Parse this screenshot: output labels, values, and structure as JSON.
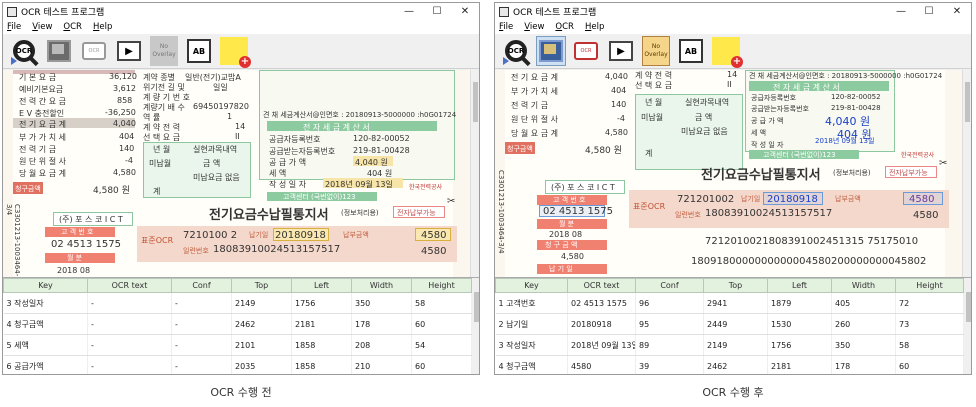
{
  "left": {
    "title": "OCR 테스트 프로그램",
    "menu": [
      "File",
      "View",
      "OCR",
      "Help"
    ],
    "toolbar": {
      "no_overlay": "No Overlay",
      "ocr_label": "OCR"
    },
    "document": {
      "rows": [
        {
          "label": "기 본 요 금",
          "value": "36,120"
        },
        {
          "label": "예비기본요금",
          "value": "3,612"
        },
        {
          "label": "전 력 간 요 금",
          "value": "858"
        },
        {
          "label": "E V 충전할인",
          "value": "-36,250"
        },
        {
          "label": "전 기 요 금 계",
          "value": "4,040"
        },
        {
          "label": "부 가 가 치 세",
          "value": "404"
        },
        {
          "label": "전    력    기 금",
          "value": "140"
        },
        {
          "label": "원 단 위 절 사",
          "value": "-4"
        },
        {
          "label": "당 월 요 금 계",
          "value": "4,580"
        }
      ],
      "request_label": "청구금액",
      "request_value": "4,580 원",
      "mid_labels": [
        "계약 종별",
        "위기전 길 및",
        "계 량 기 번 호",
        "계량기 배 수",
        "역 률",
        "계 약 전 력",
        "선 택 요 금"
      ],
      "mid_values": [
        "일반(전기)교밥A",
        "일일",
        "69450197820",
        "1",
        "90",
        "14",
        "II"
      ],
      "bill_title": "전기요금수납필통지서",
      "bill_sub": "(정보처리용)",
      "tax_title": "전 자 세 금 계 산 서",
      "tax_header": "견 채 세금계산서@인면호 : 20180913-5000000 :h0G01724",
      "tax_rows": [
        {
          "label": "공급자등록번호",
          "value": "120-82-00052"
        },
        {
          "label": "공급받는자등록번호",
          "value": "219-81-00428"
        },
        {
          "label": "공 급 가 액",
          "value": "4,040 원"
        },
        {
          "label": "세 액",
          "value": "404 원"
        },
        {
          "label": "작 성 일 자",
          "value": "2018년 09월 13일"
        }
      ],
      "customer_center": "고객센터 (국번없이)123",
      "company": "(주) 포 스 코 I C T",
      "customer_no_label": "고 객 번 호",
      "customer_no": "02 4513 1575",
      "month_label": "월 분",
      "month": "2018 08",
      "ocr_label": "표준OCR",
      "biz_no": "7210100 2",
      "date_label": "납기일",
      "date": "20180918",
      "pay_label": "납부금액",
      "pay": "4580",
      "account_label": "일련번호",
      "account": "18083910024513157517",
      "pay2": "4580",
      "side_code": "C3301213-1003464-3/4",
      "usage_month": "2018 08",
      "usage_col": [
        "년 월",
        "실현과목내역"
      ],
      "usage_col2": [
        "미납월",
        "금 액"
      ],
      "usage_none": "미납요금 없음",
      "usage_total": "계",
      "electronic_label": "전자납부가능",
      "kepco": "한국전력공사"
    },
    "grid": {
      "columns": [
        "Key",
        "OCR text",
        "Conf",
        "Top",
        "Left",
        "Width",
        "Height"
      ],
      "rows": [
        [
          "3 작성일자",
          "-",
          "-",
          "2149",
          "1756",
          "350",
          "58"
        ],
        [
          "4 청구금액",
          "-",
          "-",
          "2462",
          "2181",
          "178",
          "60"
        ],
        [
          "5 세액",
          "-",
          "-",
          "2101",
          "1858",
          "208",
          "54"
        ],
        [
          "6 공급가액",
          "-",
          "-",
          "2035",
          "1858",
          "210",
          "60"
        ]
      ]
    },
    "caption": "OCR 수행 전"
  },
  "right": {
    "title": "OCR 테스트 프로그램",
    "menu": [
      "File",
      "View",
      "OCR",
      "Help"
    ],
    "toolbar": {
      "no_overlay": "No Overlay",
      "ocr_label": "OCR"
    },
    "document": {
      "top_row": "계 약 전 력",
      "top_value": "14",
      "rows": [
        {
          "label": "전 기 요 금 계",
          "value": "4,040"
        },
        {
          "label": "부 가 가 치 세",
          "value": "404"
        },
        {
          "label": "전    력    기 금",
          "value": "140"
        },
        {
          "label": "원 단 위 절 사",
          "value": "-4"
        },
        {
          "label": "당 월 요 금 계",
          "value": "4,580"
        }
      ],
      "request_label": "청구금액",
      "request_value": "4,580 원",
      "sel_label": "선 택 요 금",
      "sel_value": "II",
      "tax_header": "견 채 세금계산서@인면호 : 20180913-5000000 :h0G01724",
      "tax_title": "전 자 세 금 계 산 서",
      "tax_rows": [
        {
          "label": "공급자등록번호",
          "value": "120-82-00052"
        },
        {
          "label": "공급받는자등록번호",
          "value": "219-81-00428"
        },
        {
          "label": "공 급 가 액",
          "value": "4,040 원"
        },
        {
          "label": "세 액",
          "value": "404 원"
        },
        {
          "label": "작 성 일 자",
          "value": "2018년 09월 13일"
        }
      ],
      "customer_center": "고객센터 (국번없이)123",
      "bill_title": "전기요금수납필통지서",
      "bill_sub": "(정보처리용)",
      "company": "(주) 포 스 코 I C T",
      "customer_no_label": "고 객 번 호",
      "customer_no": "02 4513 1575",
      "month_label": "월 분",
      "month": "2018 08",
      "ocr_label": "표준OCR",
      "biz_no": "721201002",
      "date_label": "납기일",
      "date": "20180918",
      "pay_label": "납부금액",
      "pay": "4580",
      "account_label": "일련번호",
      "account": "18083910024513157517",
      "pay2": "4580",
      "request_label2": "청 구 금 액",
      "request_value2": "4,580",
      "due_label": "납 기 일",
      "long1": "7212010021808391002451315 75175010",
      "long2": "1809180000000000004580200000000045802",
      "side_code": "C3301213-1003464-3/4",
      "usage_col": [
        "년 월",
        "실현과목내역"
      ],
      "usage_col2": [
        "미납월",
        "금 액"
      ],
      "usage_none": "미납요금 없음",
      "usage_total": "계",
      "electronic_label": "전자납부가능",
      "kepco": "한국전력공사"
    },
    "grid": {
      "columns": [
        "Key",
        "OCR text",
        "Conf",
        "Top",
        "Left",
        "Width",
        "Height"
      ],
      "rows": [
        [
          "1 고객번호",
          "02 4513 1575",
          "96",
          "2941",
          "1879",
          "405",
          "72"
        ],
        [
          "2 납기일",
          "20180918",
          "95",
          "2449",
          "1530",
          "260",
          "73"
        ],
        [
          "3 작성일자",
          "2018년 09월 13일",
          "89",
          "2149",
          "1756",
          "350",
          "58"
        ],
        [
          "4 청구금액",
          "4580",
          "39",
          "2462",
          "2181",
          "178",
          "60"
        ]
      ]
    },
    "caption": "OCR 수행 후"
  }
}
